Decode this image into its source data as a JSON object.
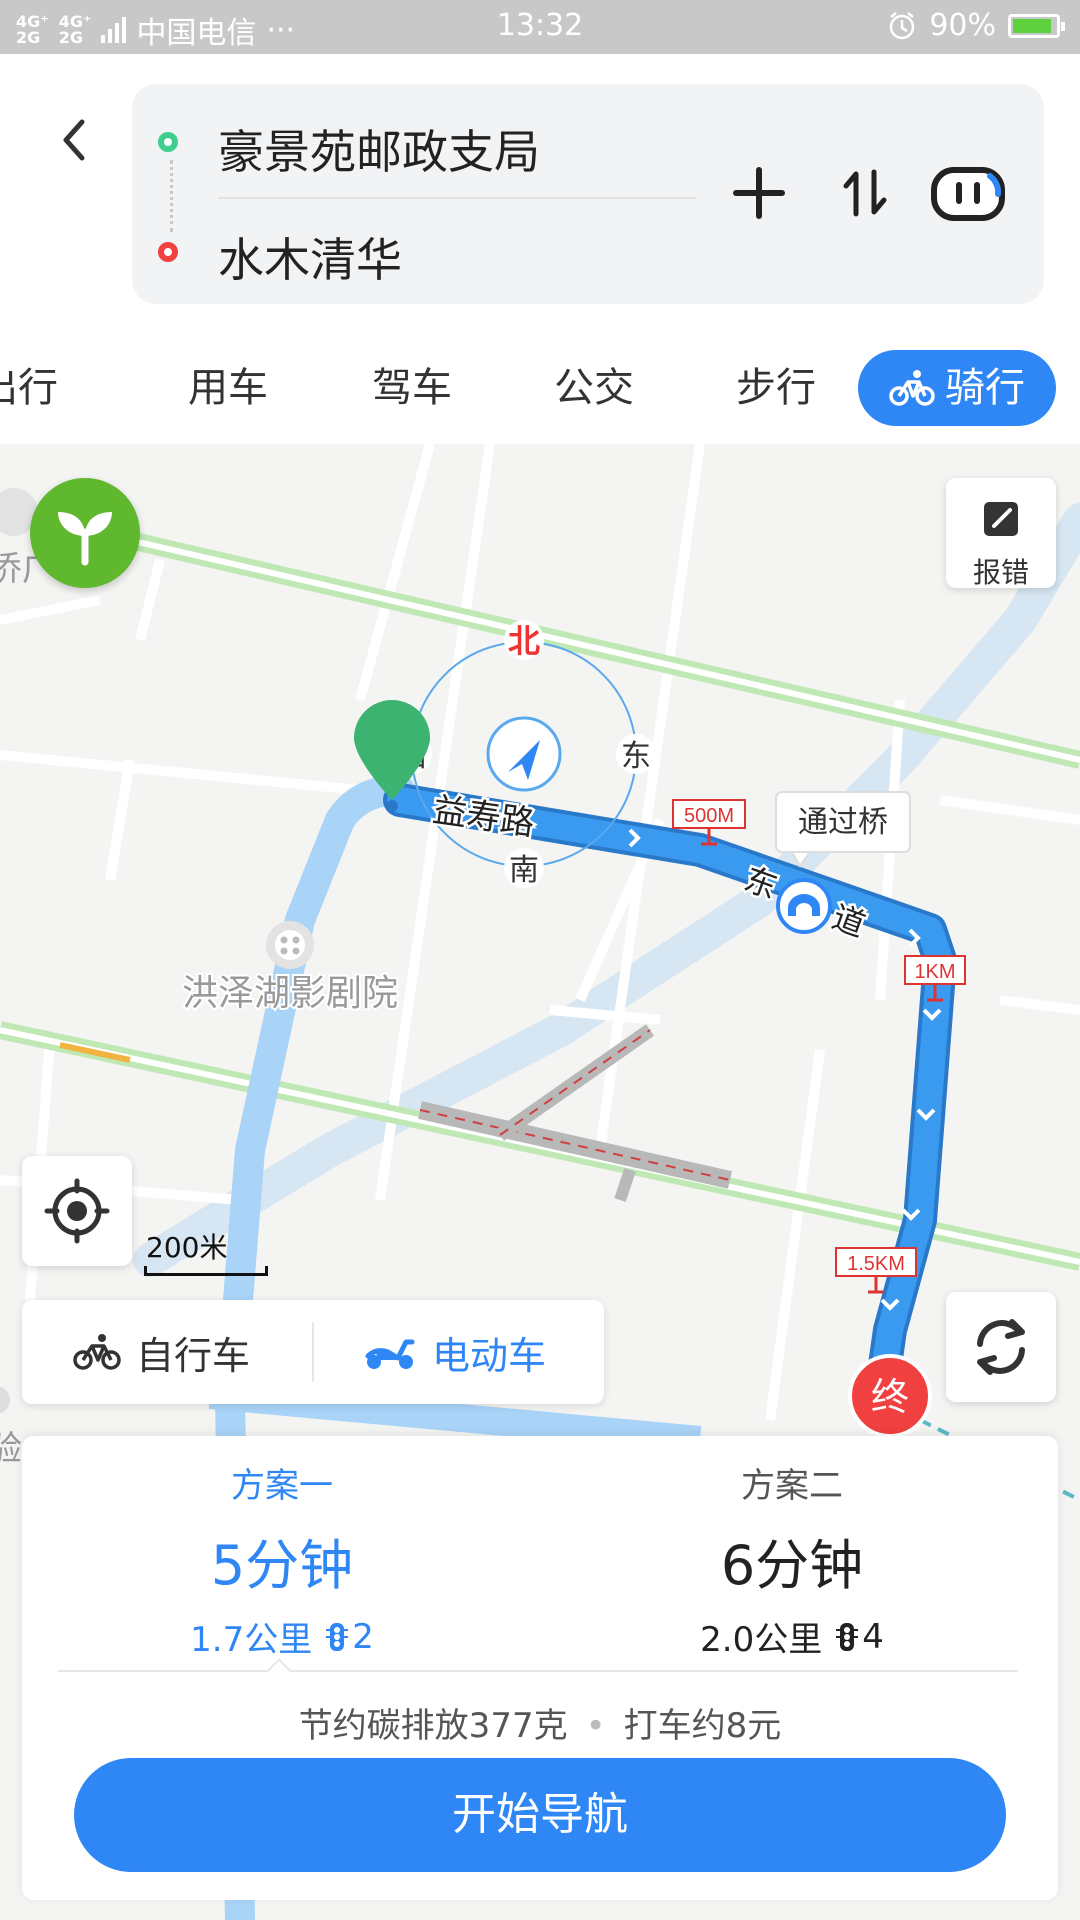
{
  "status_bar": {
    "network1": "4G⁺ 2G",
    "network2": "4G⁺ 2G",
    "carrier": "中国电信",
    "more": "···",
    "time": "13:32",
    "battery_text": "90%",
    "battery_level": 0.9
  },
  "route": {
    "start": "豪景苑邮政支局",
    "end": "水木清华"
  },
  "tabs": [
    {
      "label": "出行"
    },
    {
      "label": "用车"
    },
    {
      "label": "驾车"
    },
    {
      "label": "公交"
    },
    {
      "label": "步行"
    },
    {
      "label": "骑行",
      "active": true
    }
  ],
  "map": {
    "poi_cinema": "洪泽湖影剧院",
    "road_label": "益寿路",
    "compass": {
      "north": "北",
      "east": "东",
      "south": "南",
      "west": "西"
    },
    "bridge_label": "通过桥",
    "road_label2": "东",
    "road_label3": "道",
    "distance_markers": [
      "500M",
      "1KM",
      "1.5KM"
    ],
    "end_marker": "终",
    "left_edge_text1": "侨广",
    "left_edge_text2": "验",
    "report_label": "报错",
    "scale_label": "200米"
  },
  "vehicle": {
    "bike": "自行车",
    "ebike": "电动车",
    "selected": "ebike"
  },
  "plans": [
    {
      "name": "方案一",
      "time": "5分钟",
      "distance": "1.7公里",
      "lights": "2",
      "selected": true
    },
    {
      "name": "方案二",
      "time": "6分钟",
      "distance": "2.0公里",
      "lights": "4",
      "selected": false
    }
  ],
  "tip": {
    "carbon": "节约碳排放377克",
    "sep": "•",
    "taxi": "打车约8元"
  },
  "start_button": "开始导航",
  "colors": {
    "accent": "#2f86f5",
    "route": "#3a9af0",
    "alt_route": "#a9d3f7",
    "start": "#3ecf8e",
    "end": "#f04040"
  }
}
